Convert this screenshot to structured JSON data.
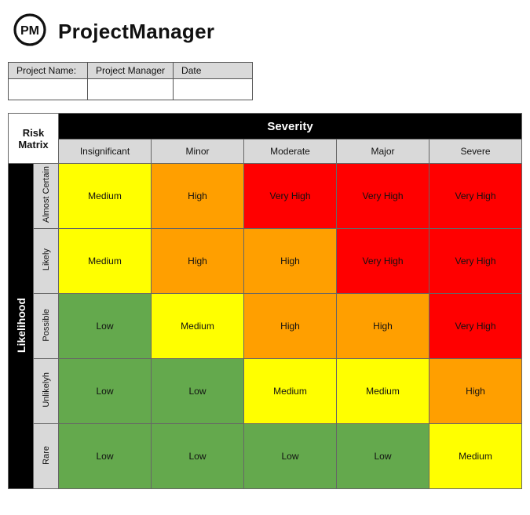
{
  "brand": {
    "initials": "PM",
    "name": "ProjectManager"
  },
  "meta": {
    "labels": {
      "project": "Project Name:",
      "manager": "Project Manager",
      "date": "Date"
    },
    "values": {
      "project": "",
      "manager": "",
      "date": ""
    }
  },
  "matrix": {
    "title": "Risk Matrix",
    "severity_label": "Severity",
    "likelihood_label": "Likelihood",
    "severity_levels": [
      "Insignificant",
      "Minor",
      "Moderate",
      "Major",
      "Severe"
    ],
    "likelihood_levels": [
      "Almost Certain",
      "Likely",
      "Possible",
      "Unlikelyh",
      "Rare"
    ],
    "cells": [
      [
        "Medium",
        "High",
        "Very High",
        "Very High",
        "Very High"
      ],
      [
        "Medium",
        "High",
        "High",
        "Very High",
        "Very High"
      ],
      [
        "Low",
        "Medium",
        "High",
        "High",
        "Very High"
      ],
      [
        "Low",
        "Low",
        "Medium",
        "Medium",
        "High"
      ],
      [
        "Low",
        "Low",
        "Low",
        "Low",
        "Medium"
      ]
    ]
  },
  "chart_data": {
    "type": "heatmap",
    "title": "Risk Matrix",
    "xlabel": "Severity",
    "ylabel": "Likelihood",
    "x_categories": [
      "Insignificant",
      "Minor",
      "Moderate",
      "Major",
      "Severe"
    ],
    "y_categories": [
      "Almost Certain",
      "Likely",
      "Possible",
      "Unlikelyh",
      "Rare"
    ],
    "values": [
      [
        "Medium",
        "High",
        "Very High",
        "Very High",
        "Very High"
      ],
      [
        "Medium",
        "High",
        "High",
        "Very High",
        "Very High"
      ],
      [
        "Low",
        "Medium",
        "High",
        "High",
        "Very High"
      ],
      [
        "Low",
        "Low",
        "Medium",
        "Medium",
        "High"
      ],
      [
        "Low",
        "Low",
        "Low",
        "Low",
        "Medium"
      ]
    ],
    "scale": [
      "Low",
      "Medium",
      "High",
      "Very High"
    ],
    "scale_colors": {
      "Low": "#64a94d",
      "Medium": "#ffff00",
      "High": "#ff9f00",
      "Very High": "#ff0000"
    }
  }
}
